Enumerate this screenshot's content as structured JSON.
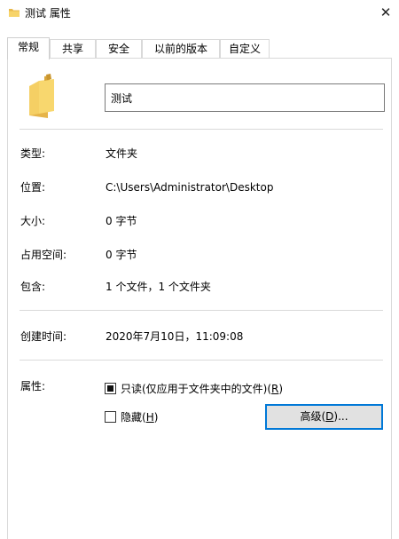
{
  "window": {
    "title": "测试 属性",
    "close_glyph": "✕"
  },
  "tabs": [
    {
      "label": "常规",
      "active": true
    },
    {
      "label": "共享"
    },
    {
      "label": "安全"
    },
    {
      "label": "以前的版本"
    },
    {
      "label": "自定义"
    }
  ],
  "general": {
    "name_value": "测试",
    "type_label": "类型:",
    "type_value": "文件夹",
    "location_label": "位置:",
    "location_value": "C:\\Users\\Administrator\\Desktop",
    "size_label": "大小:",
    "size_value": "0 字节",
    "disk_size_label": "占用空间:",
    "disk_size_value": "0 字节",
    "contains_label": "包含:",
    "contains_value": "1 个文件，1 个文件夹",
    "created_label": "创建时间:",
    "created_value": "2020年7月10日，11:09:08",
    "attributes_label": "属性:",
    "readonly_label": "只读(仅应用于文件夹中的文件)(",
    "readonly_key": "R",
    "readonly_close": ")",
    "readonly_checked": true,
    "hidden_label": "隐藏(",
    "hidden_key": "H",
    "hidden_close": ")",
    "hidden_checked": false,
    "advanced_label": "高级(",
    "advanced_key": "D",
    "advanced_close": ")..."
  },
  "colors": {
    "folder": "#f4c95a",
    "button_focus": "#0078d7"
  }
}
